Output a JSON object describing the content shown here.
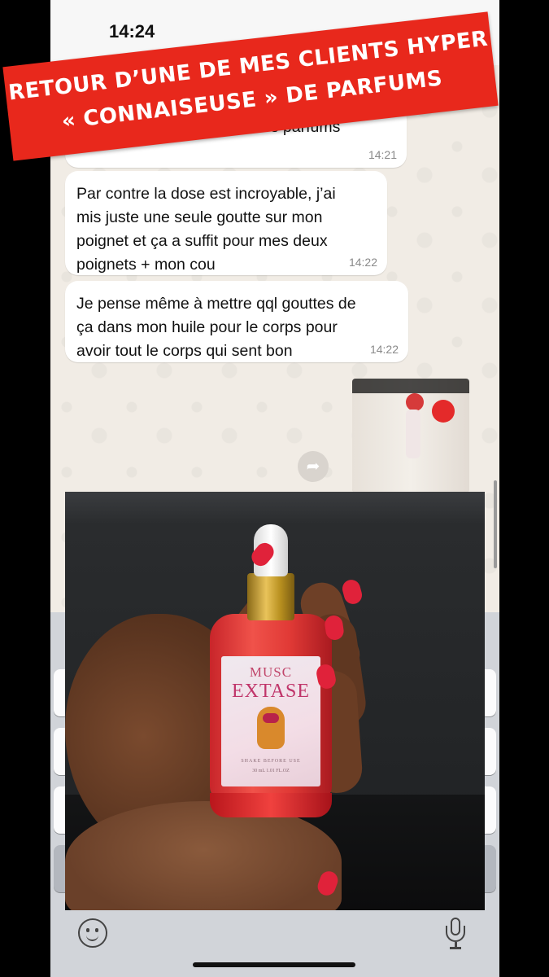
{
  "status_bar": {
    "time": "14:24"
  },
  "banner": {
    "line1": "RETOUR D’UNE DE MES CLIENTS HYPER",
    "line2": "« CONNAISEUSE » DE PARFUMS",
    "color": "#e8281c"
  },
  "messages": [
    {
      "text": "tres parfums",
      "time": "14:21"
    },
    {
      "lines": [
        "Par contre la dose est incroyable, j’ai",
        "mis juste une seule goutte sur mon",
        "poignet et ça a suffit pour mes deux",
        "poignets + mon cou"
      ],
      "time": "14:22"
    },
    {
      "lines": [
        "Je pense même à mettre qql gouttes de",
        "ça dans mon huile pour le corps pour",
        "avoir tout le corps qui sent bon"
      ],
      "time": "14:22"
    }
  ],
  "product": {
    "brand_line1": "MUSC",
    "brand_line2": "EXTASE",
    "small_line1": "SHAKE BEFORE USE",
    "small_line2": "30 mL 1.01 FL.OZ"
  },
  "icons": {
    "forward": "forward-arrow-icon",
    "emoji": "emoji-icon",
    "mic": "microphone-icon"
  },
  "colors": {
    "chat_background": "#f1ece5",
    "bubble": "#ffffff",
    "nail_polish": "#e0223a",
    "bottle": "#e13a36"
  }
}
